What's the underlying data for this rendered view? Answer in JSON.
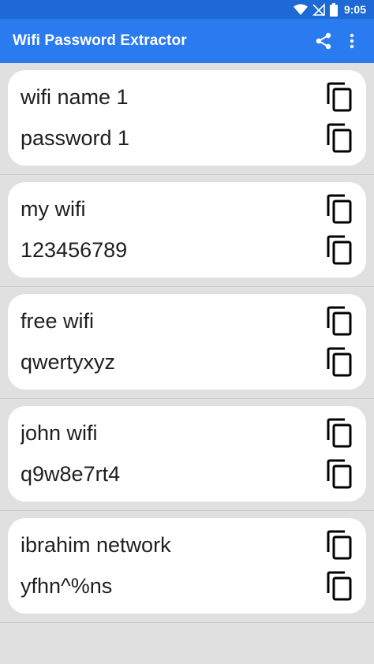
{
  "status_bar": {
    "time": "9:05",
    "icons": [
      "wifi-icon",
      "no-signal-icon",
      "battery-icon"
    ]
  },
  "app_bar": {
    "title": "Wifi Password Extractor",
    "actions": [
      "share-icon",
      "more-vert-icon"
    ],
    "color": "#2a7bf0"
  },
  "networks": [
    {
      "name": "wifi name 1",
      "password": "password 1"
    },
    {
      "name": "my wifi",
      "password": "123456789"
    },
    {
      "name": "free wifi",
      "password": "qwertyxyz"
    },
    {
      "name": "john wifi",
      "password": "q9w8e7rt4"
    },
    {
      "name": "ibrahim network",
      "password": "yfhn^%ns"
    }
  ],
  "icons": {
    "copy": "copy-icon"
  }
}
